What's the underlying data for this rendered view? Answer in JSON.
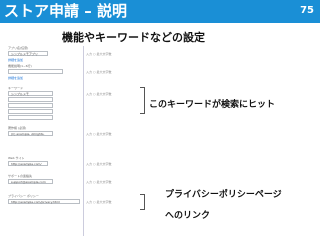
{
  "header": {
    "title": "ストア申請 – 説明",
    "page_number": "75",
    "color": "#1a8fd6"
  },
  "subtitle": "機能やキーワードなどの設定",
  "annotations": {
    "keyword": "このキーワードが検索にヒット",
    "privacy_line1": "プライバシーポリシーページ",
    "privacy_line2": "へのリンク"
  },
  "form": {
    "fields": [
      {
        "label": "アプリ名(任意)",
        "value": "シンプルメモアプリ"
      },
      {
        "label": "機能説明(1~6行)",
        "value": ""
      },
      {
        "label": "キーワード",
        "value": "シンプルメモ"
      },
      {
        "label": "著作権 (必須)",
        "value": "(C) example. Allrights."
      },
      {
        "label": "Web サイト",
        "value": "http://example.com/"
      },
      {
        "label": "サポートの連絡先",
        "value": "support@example.com"
      },
      {
        "label": "プライバシー ポリシー",
        "value": "http://example.com/privacy.html"
      }
    ],
    "hint": "入力 ○ 最大文字数",
    "more_link": "詳細を追加"
  }
}
